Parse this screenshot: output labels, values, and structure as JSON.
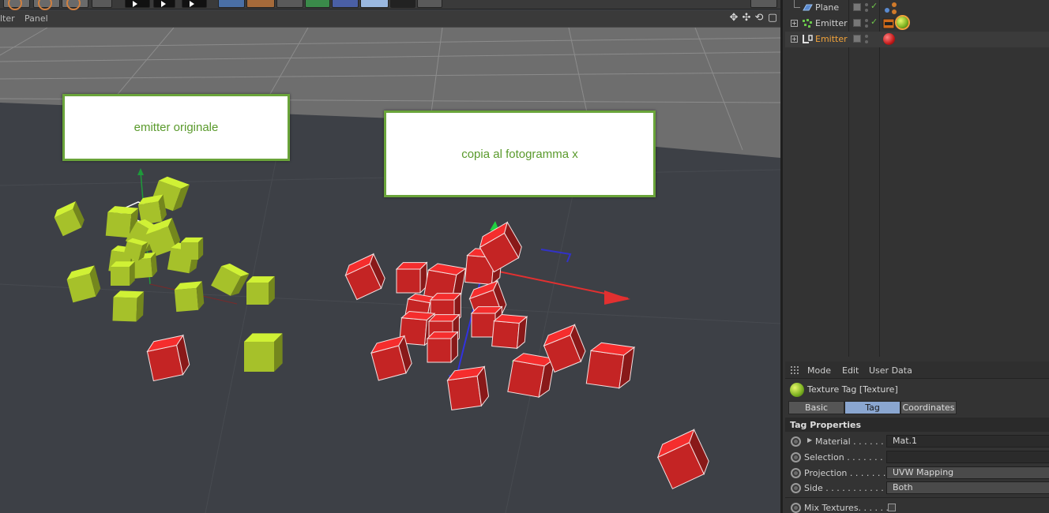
{
  "viewport": {
    "menu": [
      "lter",
      "Panel"
    ],
    "annotations": {
      "left": "emitter originale",
      "right": "copia al fotogramma x"
    },
    "nav_icons": [
      "move-view-icon",
      "pan-view-icon",
      "rotate-view-icon",
      "maximize-view-icon"
    ]
  },
  "object_manager": {
    "rows": [
      {
        "name": "Plane",
        "icon": "plane-icon",
        "tags": [
          "null-tags-icon"
        ]
      },
      {
        "name": "Emitter",
        "icon": "emitter-icon",
        "tags": [
          "cache-tag-icon",
          "texture-tag-green-icon"
        ]
      },
      {
        "name": "Emitter",
        "icon": "layer-emitter-icon",
        "active": true,
        "tags": [
          "texture-tag-red-icon"
        ]
      }
    ]
  },
  "attributes": {
    "menu": [
      "Mode",
      "Edit",
      "User Data"
    ],
    "title": "Texture Tag [Texture]",
    "tabs": [
      "Basic",
      "Tag",
      "Coordinates"
    ],
    "active_tab": "Tag",
    "section_title": "Tag Properties",
    "properties": [
      {
        "label": "Material . . . . . . . .",
        "value": "Mat.1",
        "type": "link"
      },
      {
        "label": "Selection . . . . . . . .",
        "value": "",
        "type": "text"
      },
      {
        "label": "Projection . . . . . . .",
        "value": "UVW Mapping",
        "type": "dropdown"
      },
      {
        "label": "Side . . . . . . . . . . . .",
        "value": "Both",
        "type": "dropdown"
      },
      {
        "label": "Mix Textures. . . . . .",
        "value": "",
        "type": "checkbox"
      }
    ]
  },
  "colors": {
    "green_cube": "#a6c12a",
    "red_cube": "#c42424",
    "annotation_border": "#6aa43a",
    "annotation_text": "#5a9a2c",
    "active_object": "#f2a33a",
    "active_tab": "#8aa6d0"
  }
}
